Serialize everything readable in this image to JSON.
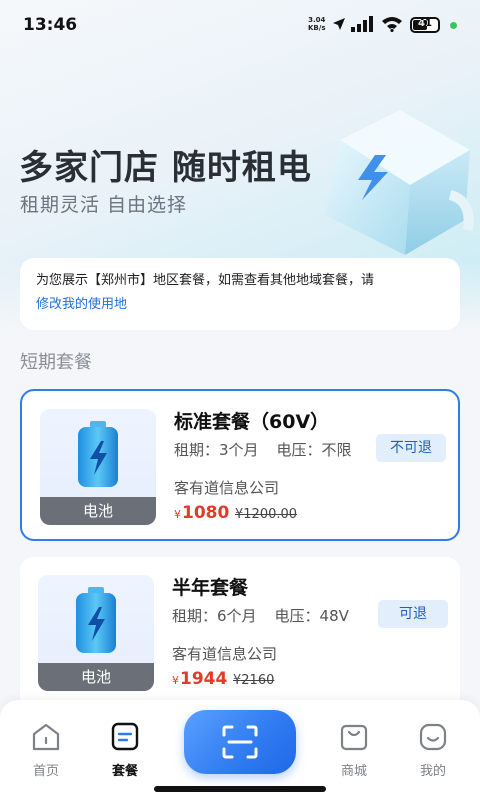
{
  "status": {
    "time": "13:46",
    "net_speed": "3.04",
    "net_unit": "KB/s",
    "battery": "41"
  },
  "hero": {
    "title": "多家门店 随时租电",
    "subtitle": "租期灵活 自由选择"
  },
  "notice": {
    "text": "为您展示【郑州市】地区套餐，如需查看其他地域套餐，请",
    "link": "修改我的使用地"
  },
  "section_title": "短期套餐",
  "plans": [
    {
      "name": "标准套餐（60V）",
      "term": "租期：3个月",
      "voltage": "电压：不限",
      "tag": "不可退",
      "company": "客有道信息公司",
      "currency": "¥",
      "price": "1080",
      "original": "¥1200.00",
      "image_caption": "电池"
    },
    {
      "name": "半年套餐",
      "term": "租期：6个月",
      "voltage": "电压：48V",
      "tag": "可退",
      "company": "客有道信息公司",
      "currency": "¥",
      "price": "1944",
      "original": "¥2160",
      "image_caption": "电池"
    }
  ],
  "tabs": [
    {
      "label": "首页",
      "icon": "home-icon"
    },
    {
      "label": "套餐",
      "icon": "plan-icon"
    },
    {
      "label": "商城",
      "icon": "shop-bag-icon"
    },
    {
      "label": "我的",
      "icon": "profile-icon"
    }
  ],
  "colors": {
    "accent": "#2f7bf0",
    "price": "#e23a2b",
    "tag_bg": "#e3eefc"
  }
}
